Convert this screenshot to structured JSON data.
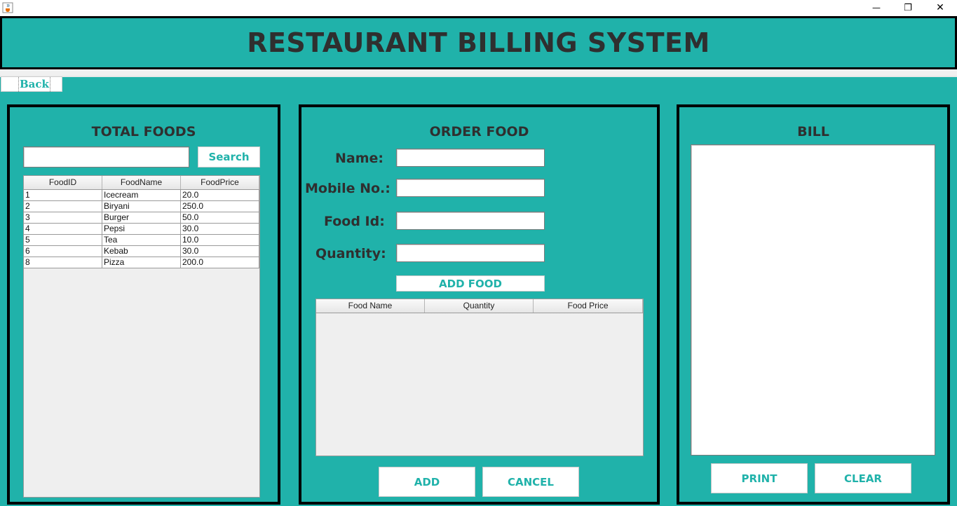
{
  "window": {
    "app_icon": "java-cup-icon",
    "minimize_glyph": "—",
    "maximize_glyph": "❐",
    "close_glyph": "✕"
  },
  "header": {
    "title": "RESTAURANT BILLING SYSTEM"
  },
  "nav": {
    "back_label": "Back"
  },
  "total_foods": {
    "title": "TOTAL FOODS",
    "search_value": "",
    "search_label": "Search",
    "columns": [
      "FoodID",
      "FoodName",
      "FoodPrice"
    ],
    "rows": [
      [
        "1",
        "Icecream",
        "20.0"
      ],
      [
        "2",
        "Biryani",
        "250.0"
      ],
      [
        "3",
        "Burger",
        "50.0"
      ],
      [
        "4",
        "Pepsi",
        "30.0"
      ],
      [
        "5",
        "Tea",
        "10.0"
      ],
      [
        "6",
        "Kebab",
        "30.0"
      ],
      [
        "8",
        "Pizza",
        "200.0"
      ]
    ]
  },
  "order_food": {
    "title": "ORDER FOOD",
    "name_label": "Name:",
    "name_value": "",
    "mobile_label": "Mobile No.:",
    "mobile_value": "",
    "food_id_label": "Food Id:",
    "food_id_value": "",
    "quantity_label": "Quantity:",
    "quantity_value": "",
    "add_food_label": "ADD FOOD",
    "columns": [
      "Food Name",
      "Quantity",
      "Food Price"
    ],
    "add_label": "ADD",
    "cancel_label": "CANCEL"
  },
  "bill": {
    "title": "BILL",
    "text": "",
    "print_label": "PRINT",
    "clear_label": "CLEAR"
  },
  "colors": {
    "accent": "#20b2aa",
    "title_text": "#2f2f2f",
    "border": "#000000"
  }
}
